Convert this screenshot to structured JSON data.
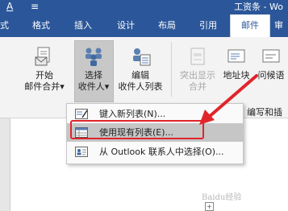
{
  "titlebar": {
    "font_glyph": "A",
    "underline_glyph": "≡",
    "title": "工资条 - Wo"
  },
  "tabs": [
    {
      "label": "式"
    },
    {
      "label": "格式"
    },
    {
      "label": "插入"
    },
    {
      "label": "设计"
    },
    {
      "label": "布局"
    },
    {
      "label": "引用"
    },
    {
      "label": "邮件",
      "active": true
    },
    {
      "label": "审"
    }
  ],
  "ribbon": {
    "start_merge": {
      "line1": "开始",
      "line2": "邮件合并▾"
    },
    "select_recipients": {
      "line1": "选择",
      "line2": "收件人▾"
    },
    "edit_recipients": {
      "line1": "编辑",
      "line2": "收件人列表"
    },
    "highlight_fields": {
      "line1": "突出显示",
      "line2": "合并"
    },
    "address_block": {
      "line1": "地址块"
    },
    "greeting_line": {
      "line1": "问候语"
    },
    "group_label": "编写和插"
  },
  "dropdown": {
    "items": [
      {
        "label": "键入新列表(N)...",
        "icon": "new-list-icon"
      },
      {
        "label": "使用现有列表(E)...",
        "icon": "existing-list-icon",
        "highlighted": true
      },
      {
        "label": "从 Outlook 联系人中选择(O)...",
        "icon": "outlook-contacts-icon"
      }
    ]
  },
  "annotation_color": "#e0252b",
  "document": {
    "anchor_glyph": "+",
    "watermark": "Baidu经验"
  }
}
